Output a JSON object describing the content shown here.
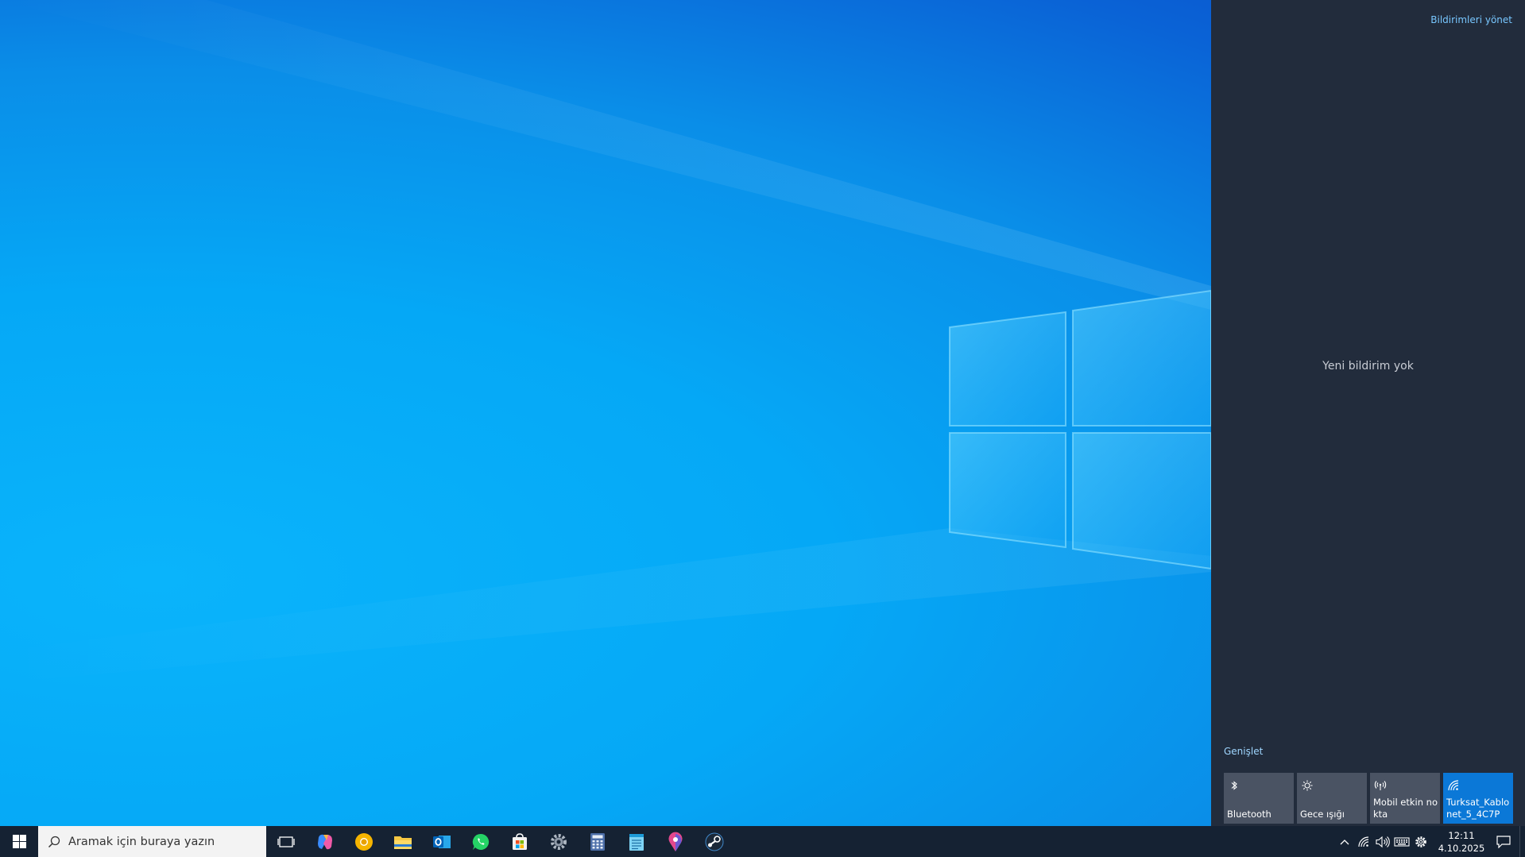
{
  "action_center": {
    "manage_notifications": "Bildirimleri yönet",
    "no_notifications": "Yeni bildirim yok",
    "expand": "Genişlet",
    "quick_actions": [
      {
        "label": "Bluetooth",
        "icon": "bluetooth-icon",
        "active": false
      },
      {
        "label": "Gece ışığı",
        "icon": "night-light-icon",
        "active": false
      },
      {
        "label": "Mobil etkin nokta",
        "icon": "mobile-hotspot-icon",
        "active": false
      },
      {
        "label": "Turksat_Kablonet_5_4C7P",
        "icon": "wifi-icon",
        "active": true
      }
    ]
  },
  "taskbar": {
    "search_placeholder": "Aramak için buraya yazın",
    "apps": [
      "task-view-icon",
      "copilot-icon",
      "chrome-canary-icon",
      "file-explorer-icon",
      "outlook-icon",
      "whatsapp-icon",
      "microsoft-store-icon",
      "settings-icon",
      "calculator-icon",
      "notepad-icon",
      "maps-icon",
      "steam-icon"
    ],
    "tray": [
      "show-hidden-icons-chevron",
      "network-icon",
      "volume-icon",
      "keyboard-icon",
      "settings-gear-icon"
    ],
    "time": "12:11",
    "date": "4.10.2025"
  },
  "colors": {
    "accent": "#0b78d7",
    "panel": "#222c3c",
    "tile": "#4a5363",
    "taskbar": "#152233",
    "link": "#78c7ff"
  }
}
